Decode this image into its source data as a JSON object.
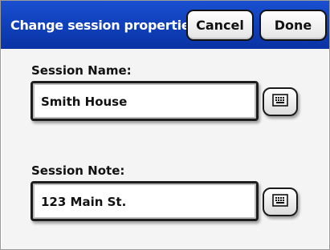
{
  "header": {
    "title": "Change session properties",
    "cancel_label": "Cancel",
    "done_label": "Done"
  },
  "session_name": {
    "label": "Session Name:",
    "value": "Smith House",
    "keyboard_icon": "keyboard-icon"
  },
  "session_note": {
    "label": "Session Note:",
    "value": "123 Main St.",
    "keyboard_icon": "keyboard-icon"
  },
  "colors": {
    "titlebar": "#0f3fb8",
    "title_text": "#ffffff",
    "content_bg": "#f4f4f4"
  }
}
